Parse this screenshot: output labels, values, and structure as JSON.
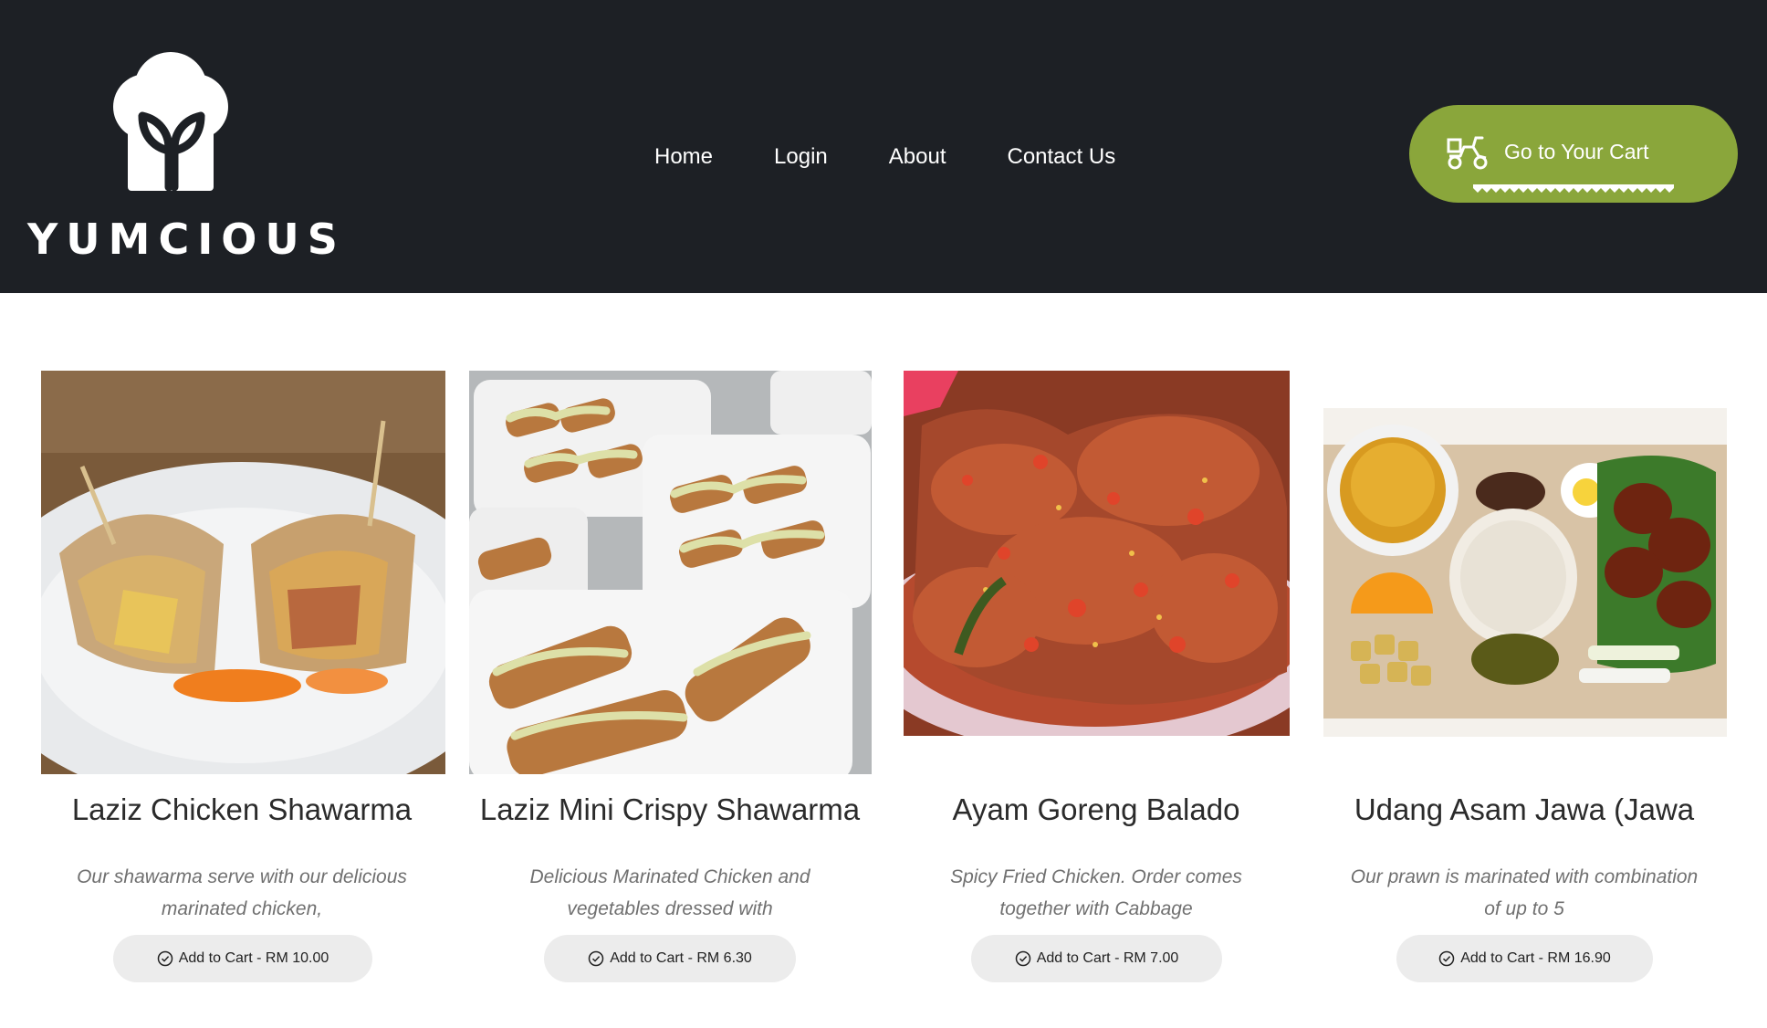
{
  "brand": {
    "name": "YUMCIOUS",
    "logo_icon": "chef-hat-sprout-icon"
  },
  "nav": {
    "items": [
      {
        "label": "Home"
      },
      {
        "label": "Login"
      },
      {
        "label": "About"
      },
      {
        "label": "Contact Us"
      }
    ]
  },
  "cart": {
    "label": "Go to Your Cart",
    "icon": "scooter-icon",
    "color": "#8aa63b"
  },
  "colors": {
    "header_bg": "#1d2025",
    "accent": "#8aa63b",
    "button_bg": "#ececec"
  },
  "products": [
    {
      "title": "Laziz Chicken Shawarma",
      "description": "Our shawarma serve with our delicious marinated chicken,",
      "button_label": "Add to Cart - RM 10.00",
      "image": "chicken-shawarma-photo"
    },
    {
      "title": "Laziz Mini Crispy Shawarma",
      "description": "Delicious Marinated Chicken and vegetables dressed with",
      "button_label": "Add to Cart - RM 6.30",
      "image": "mini-crispy-shawarma-photo"
    },
    {
      "title": "Ayam Goreng Balado",
      "description": "Spicy Fried Chicken. Order comes together with Cabbage",
      "button_label": "Add to Cart - RM 7.00",
      "image": "ayam-goreng-balado-photo"
    },
    {
      "title": "Udang Asam Jawa (Jawa",
      "description": "Our prawn is marinated with combination of up to 5",
      "button_label": "Add to Cart - RM 16.90",
      "image": "udang-asam-jawa-photo"
    }
  ]
}
